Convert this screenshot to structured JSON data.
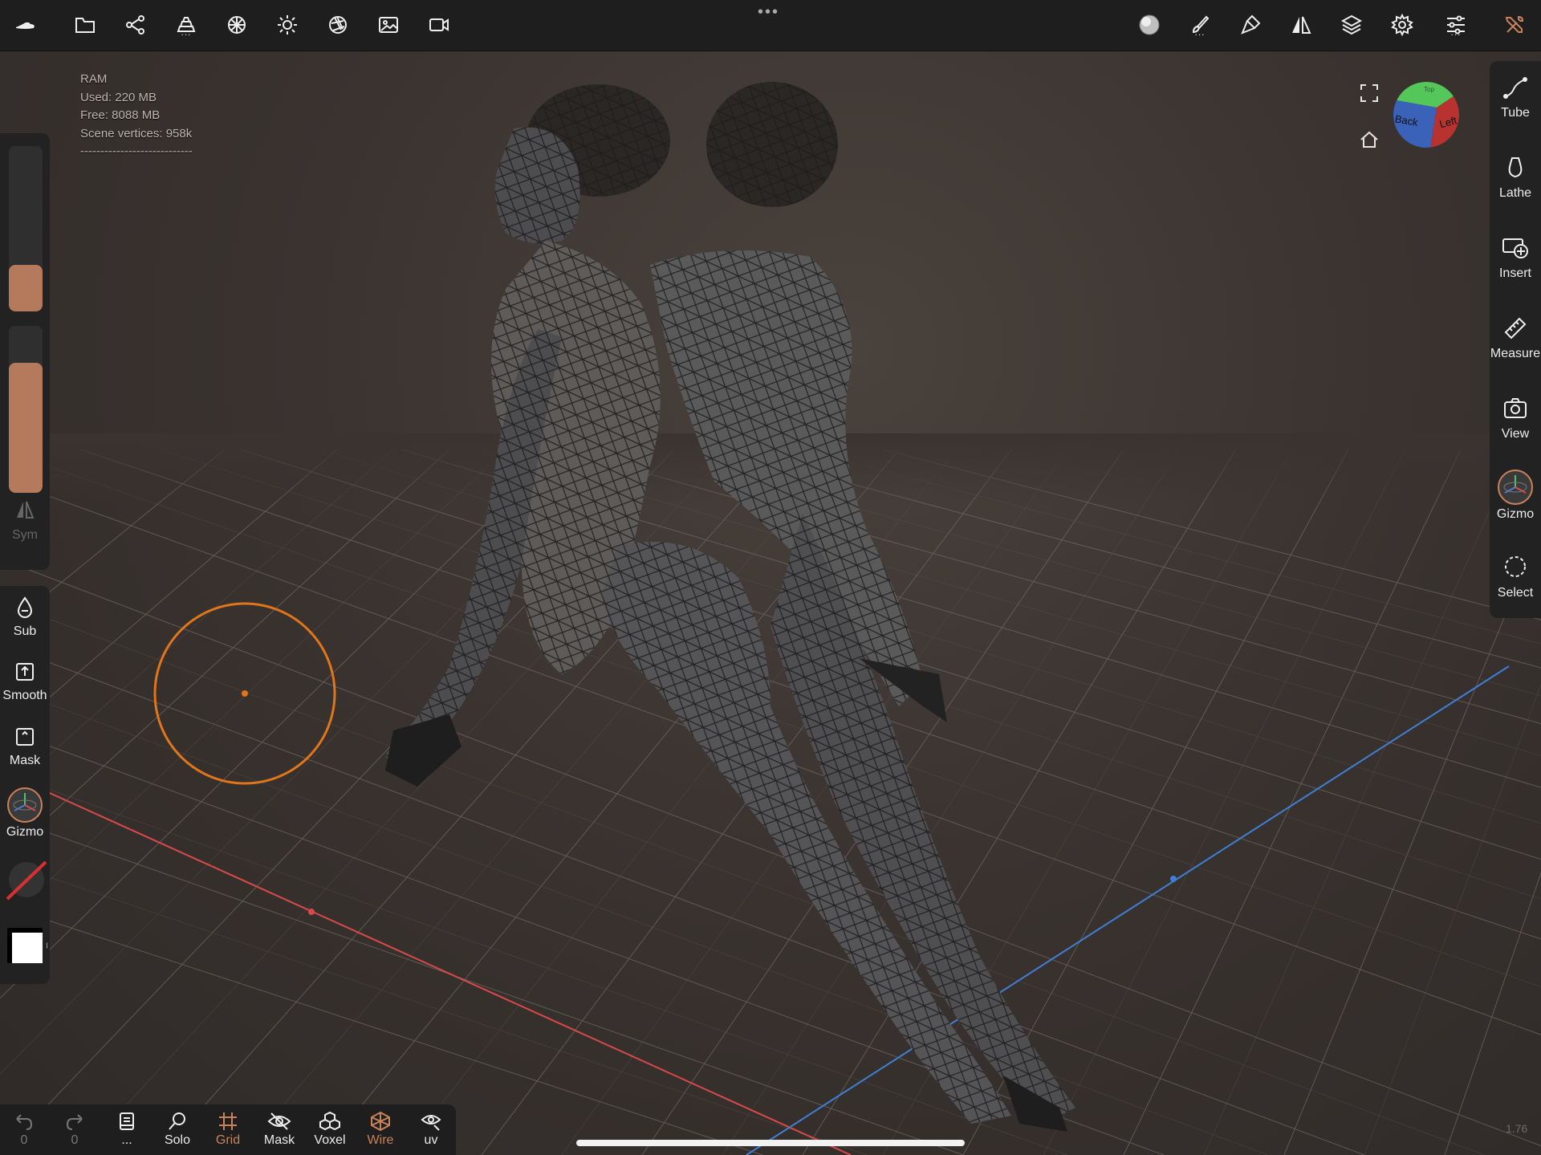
{
  "topbar": {
    "icons": [
      "boat-icon",
      "folder-icon",
      "scene-tree-icon",
      "primitives-icon",
      "topology-icon",
      "light-icon",
      "camera-shutter-icon",
      "image-icon",
      "video-camera-icon"
    ],
    "right_icons": [
      "material-sphere-icon",
      "brush-icon",
      "paint-icon",
      "symmetry-icon",
      "layers-icon",
      "settings-icon",
      "sliders-icon",
      "tools-icon"
    ],
    "dots": "...",
    "center_dots": "•••"
  },
  "stats": {
    "ram": "RAM",
    "used": "Used: 220 MB",
    "free": "Free: 8088 MB",
    "vertices": "Scene vertices: 958k",
    "separator": "----------------------------"
  },
  "sliders": {
    "radius_value": 0.28,
    "intensity_value": 0.78,
    "sym_label": "Sym"
  },
  "left_tools": {
    "sub": "Sub",
    "smooth": "Smooth",
    "mask": "Mask",
    "gizmo": "Gizmo"
  },
  "right_tools": {
    "tube": "Tube",
    "lathe": "Lathe",
    "insert": "Insert",
    "measure": "Measure",
    "view": "View",
    "gizmo": "Gizmo",
    "select": "Select"
  },
  "viewcube": {
    "back": "Back",
    "left": "Left",
    "top": "Top"
  },
  "bottombar": {
    "undo_count": "0",
    "redo_count": "0",
    "dots": "...",
    "solo": "Solo",
    "grid": "Grid",
    "mask": "Mask",
    "voxel": "Voxel",
    "wire": "Wire",
    "uv": "uv"
  },
  "colors": {
    "accent": "#c9825a",
    "brush_ring": "#e0761a",
    "slider_fill": "#b5795c",
    "panel": "#222222"
  },
  "version": "1.76"
}
